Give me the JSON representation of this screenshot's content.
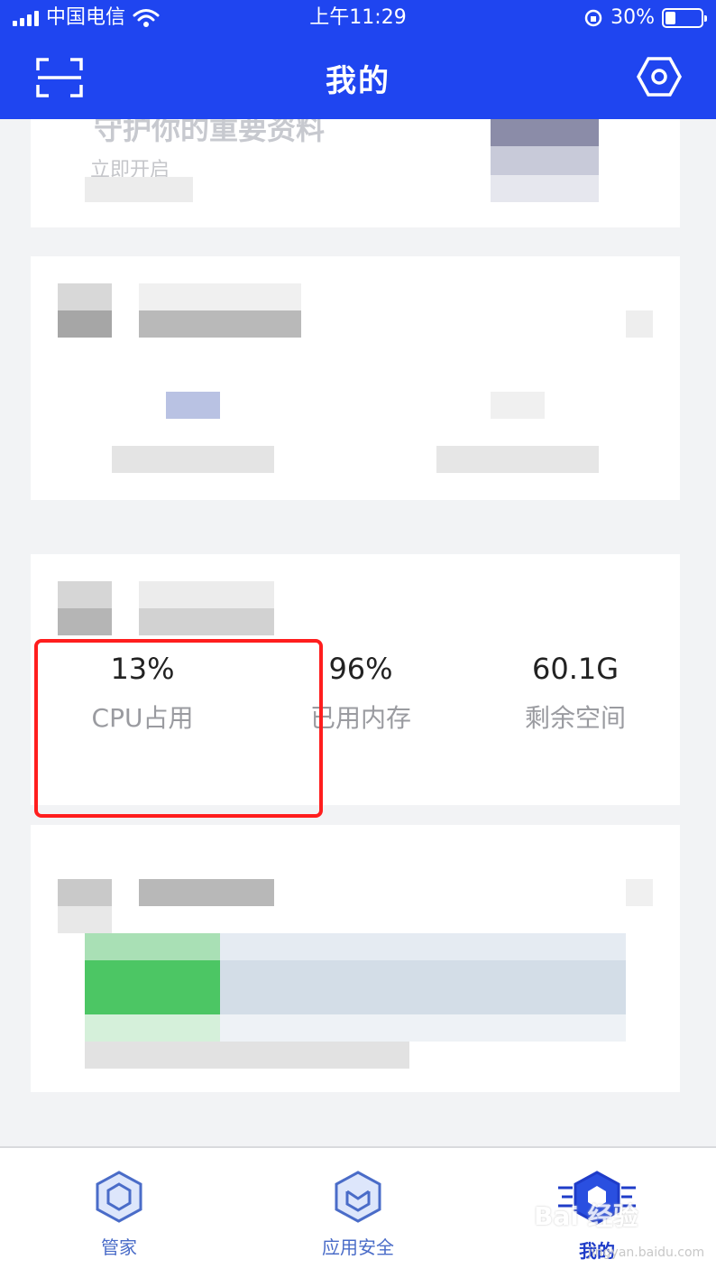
{
  "status_bar": {
    "carrier": "中国电信",
    "time": "上午11:29",
    "battery_percent": "30%",
    "battery_level": 0.3
  },
  "header": {
    "title": "我的",
    "left_icon": "scan-icon",
    "right_icon": "settings-hexagon-icon"
  },
  "cards": {
    "backup": {
      "title": "守护你的重要资料",
      "action": "立即开启"
    },
    "device": {
      "stats": [
        {
          "value": "13%",
          "label": "CPU占用"
        },
        {
          "value": "96%",
          "label": "已用内存"
        },
        {
          "value": "60.1G",
          "label": "剩余空间"
        }
      ]
    },
    "storage": {
      "used_fraction": 0.25
    }
  },
  "tabbar": {
    "tabs": [
      {
        "label": "管家",
        "icon": "hexagon-shield-icon"
      },
      {
        "label": "应用安全",
        "icon": "hexagon-box-icon"
      },
      {
        "label": "我的",
        "icon": "hexagon-user-icon"
      }
    ],
    "active": "我的"
  },
  "watermark": {
    "text": "Bai 经验",
    "sub": "jingyan.baidu.com"
  },
  "colors": {
    "header_bg": "#1f45f0",
    "highlight_border": "#ff1e1e",
    "tab_active": "#1f3cc8",
    "tab_inactive": "#4a6cc8",
    "progress_green": "#4cc664"
  }
}
